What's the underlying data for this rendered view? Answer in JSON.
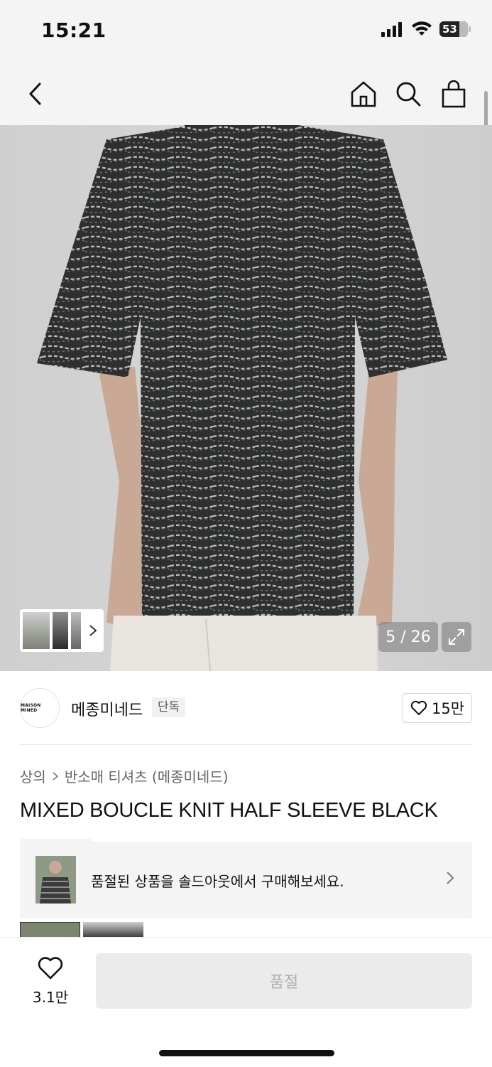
{
  "status_bar": {
    "time": "15:21",
    "battery": "53"
  },
  "nav": {
    "back_icon": "chevron-left-icon",
    "home_icon": "home-icon",
    "search_icon": "search-icon",
    "cart_icon": "shopping-bag-icon"
  },
  "gallery": {
    "counter": "5 / 26",
    "expand_icon": "expand-icon",
    "thumbs_icon": "chevron-right-icon"
  },
  "brand": {
    "logo_text": "MAISON MINED",
    "name": "메종미네드",
    "badge": "단독",
    "likes": "15만"
  },
  "product": {
    "breadcrumb": [
      "상의",
      "반소매 티셔츠 (메종미네드)"
    ],
    "title": "MIXED BOUCLE KNIT HALF SLEEVE BLACK"
  },
  "promo": {
    "text": "품절된 상품을 솔드아웃에서 구매해보세요."
  },
  "bottom": {
    "wish_count": "3.1만",
    "soldout_label": "품절"
  },
  "colors": {
    "background": "#ffffff",
    "header_bg": "#f4f4f4",
    "disabled_btn": "#ebebeb",
    "disabled_text": "#b0b0b0"
  }
}
